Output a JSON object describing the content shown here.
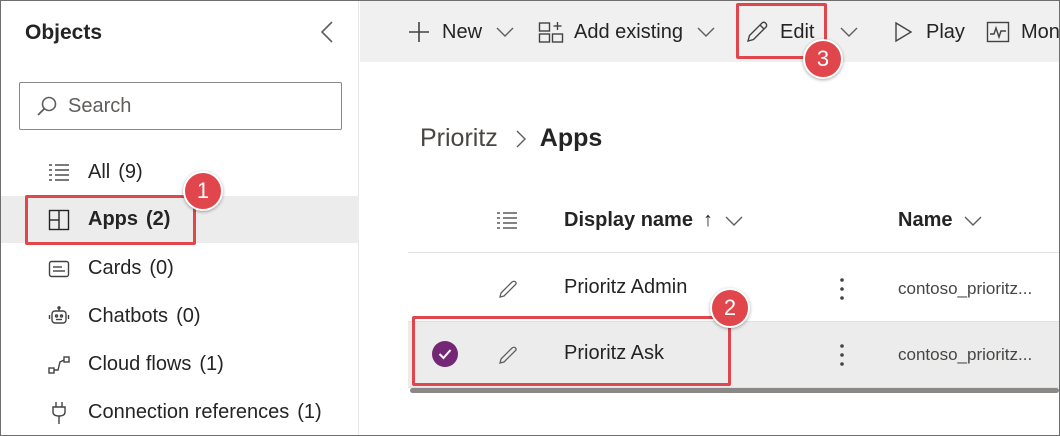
{
  "sidebar": {
    "title": "Objects",
    "search_placeholder": "Search",
    "items": [
      {
        "label": "All",
        "count": "(9)",
        "icon": "list-icon"
      },
      {
        "label": "Apps",
        "count": "(2)",
        "icon": "apps-icon"
      },
      {
        "label": "Cards",
        "count": "(0)",
        "icon": "card-icon"
      },
      {
        "label": "Chatbots",
        "count": "(0)",
        "icon": "chatbot-icon"
      },
      {
        "label": "Cloud flows",
        "count": "(1)",
        "icon": "flow-icon"
      },
      {
        "label": "Connection references",
        "count": "(1)",
        "icon": "plug-icon"
      }
    ]
  },
  "toolbar": {
    "new_label": "New",
    "add_existing_label": "Add existing",
    "edit_label": "Edit",
    "play_label": "Play",
    "monitor_label": "Mon"
  },
  "breadcrumb": {
    "parent": "Prioritz",
    "current": "Apps"
  },
  "grid": {
    "col_display_name": "Display name",
    "sort_indicator": "↑",
    "col_name": "Name",
    "rows": [
      {
        "display_name": "Prioritz Admin",
        "name": "contoso_prioritz...",
        "selected": false
      },
      {
        "display_name": "Prioritz Ask",
        "name": "contoso_prioritz...",
        "selected": true
      }
    ]
  },
  "callouts": [
    "1",
    "2",
    "3"
  ],
  "colors": {
    "highlight": "#e0464b",
    "accent": "#742774",
    "selected_row": "#ececec",
    "toolbar_bg": "#f0f0f0"
  }
}
